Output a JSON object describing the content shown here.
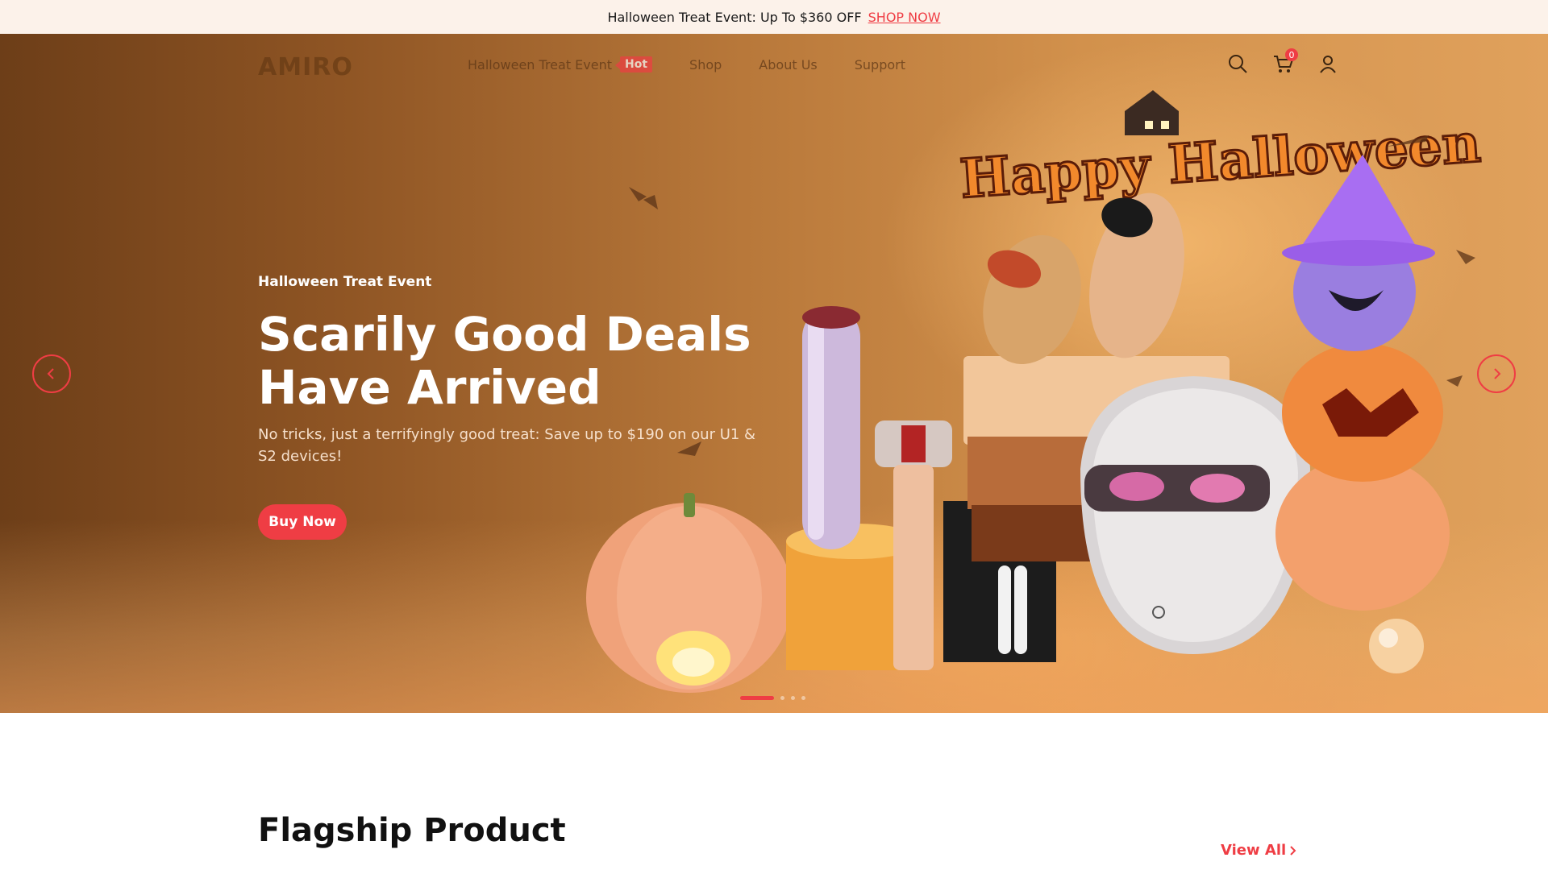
{
  "announcement": {
    "text": "Halloween Treat Event: Up To $360 OFF",
    "link_label": "SHOP NOW"
  },
  "nav": {
    "logo": "AMIRO",
    "links": [
      {
        "label": "Halloween Treat Event",
        "badge": "Hot"
      },
      {
        "label": "Shop"
      },
      {
        "label": "About Us"
      },
      {
        "label": "Support"
      }
    ],
    "cart_count": "0",
    "icons": [
      "search-icon",
      "cart-icon",
      "user-icon"
    ]
  },
  "hero": {
    "eyebrow": "Halloween Treat Event",
    "headline": "Scarily Good Deals Have Arrived",
    "subtext": "No tricks, just a terrifyingly good treat: Save up to $190 on our U1 & S2 devices!",
    "cta_label": "Buy Now",
    "banner_title": "Happy Halloween",
    "slides_total": 4,
    "slide_active": 1
  },
  "flagship": {
    "title": "Flagship Product",
    "view_all_label": "View All"
  },
  "colors": {
    "accent": "#ef3d44",
    "announce_bg": "#fcf2ea"
  }
}
